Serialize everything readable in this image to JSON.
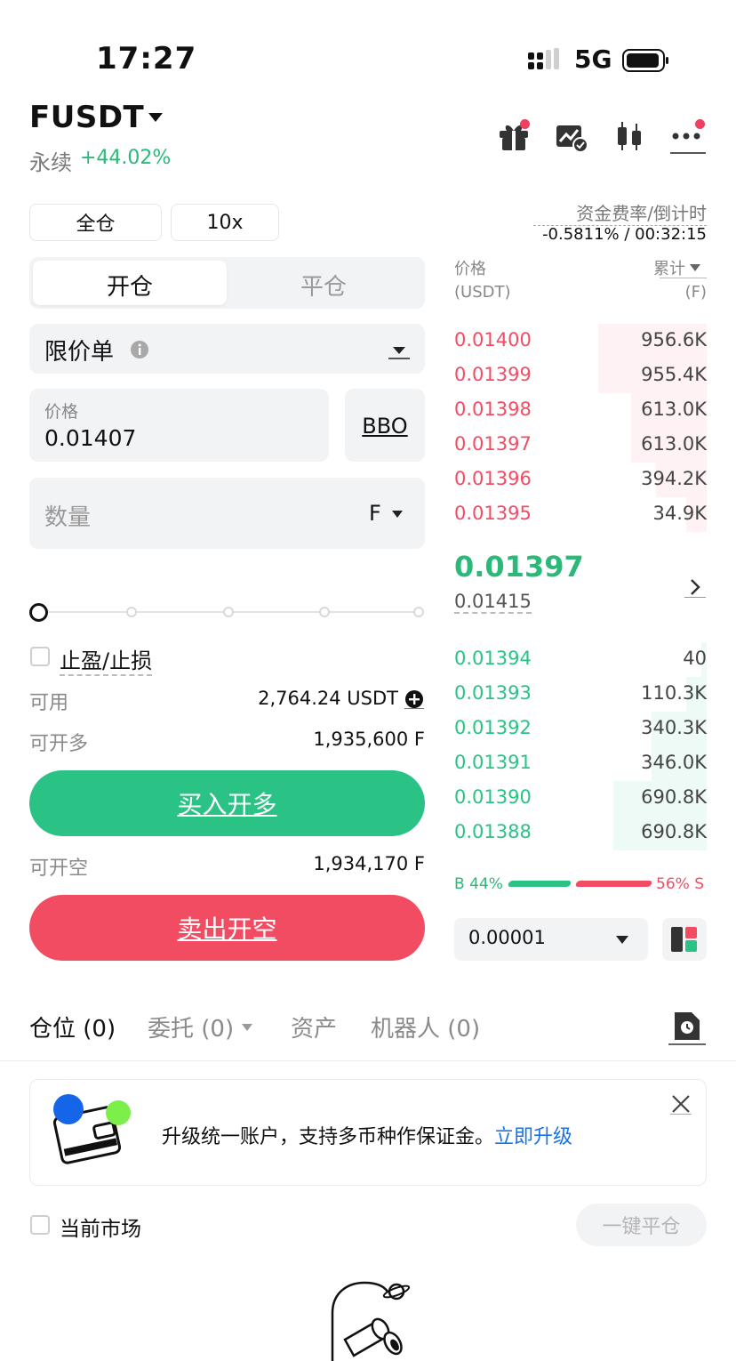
{
  "status_bar": {
    "time": "17:27",
    "network": "5G"
  },
  "header": {
    "pair": "FUSDT",
    "contract_type": "永续",
    "change": "+44.02%"
  },
  "margin": {
    "mode": "全仓",
    "leverage": "10x"
  },
  "funding": {
    "label": "资金费率/倒计时",
    "value": "-0.5811% / 00:32:15"
  },
  "order_form": {
    "tabs": [
      "开仓",
      "平仓"
    ],
    "order_type": "限价单",
    "price_label": "价格",
    "price_value": "0.01407",
    "bbo": "BBO",
    "qty_placeholder": "数量",
    "qty_unit": "F",
    "slider_percent": 0,
    "tpsl_label": "止盈/止损",
    "available_label": "可用",
    "available_value": "2,764.24 USDT",
    "can_long_label": "可开多",
    "can_long_value": "1,935,600 F",
    "buy_button": "买入开多",
    "can_short_label": "可开空",
    "can_short_value": "1,934,170 F",
    "sell_button": "卖出开空"
  },
  "orderbook": {
    "price_header": "价格",
    "price_unit": "(USDT)",
    "size_header": "累计",
    "size_unit": "(F)",
    "asks": [
      {
        "price": "0.01400",
        "size": "956.6K",
        "depth": 0.43
      },
      {
        "price": "0.01399",
        "size": "955.4K",
        "depth": 0.43
      },
      {
        "price": "0.01398",
        "size": "613.0K",
        "depth": 0.3
      },
      {
        "price": "0.01397",
        "size": "613.0K",
        "depth": 0.3
      },
      {
        "price": "0.01396",
        "size": "394.2K",
        "depth": 0.2
      },
      {
        "price": "0.01395",
        "size": "34.9K",
        "depth": 0.08
      }
    ],
    "last_price": "0.01397",
    "mark_price": "0.01415",
    "bids": [
      {
        "price": "0.01394",
        "size": "40",
        "depth": 0.02
      },
      {
        "price": "0.01393",
        "size": "110.3K",
        "depth": 0.08
      },
      {
        "price": "0.01392",
        "size": "340.3K",
        "depth": 0.22
      },
      {
        "price": "0.01391",
        "size": "346.0K",
        "depth": 0.22
      },
      {
        "price": "0.01390",
        "size": "690.8K",
        "depth": 0.37
      },
      {
        "price": "0.01388",
        "size": "690.8K",
        "depth": 0.37
      }
    ],
    "buy_ratio": "B 44%",
    "sell_ratio": "56% S",
    "tick_size": "0.00001"
  },
  "bottom_tabs": [
    "仓位 (0)",
    "委托 (0)",
    "资产",
    "机器人 (0)"
  ],
  "banner": {
    "text": "升级统一账户，支持多币种作保证金。",
    "link": "立即升级"
  },
  "current_market_label": "当前市场",
  "close_all_label": "一键平仓",
  "colors": {
    "buy": "#2bc285",
    "sell": "#f24c63",
    "link": "#1a73e8"
  }
}
